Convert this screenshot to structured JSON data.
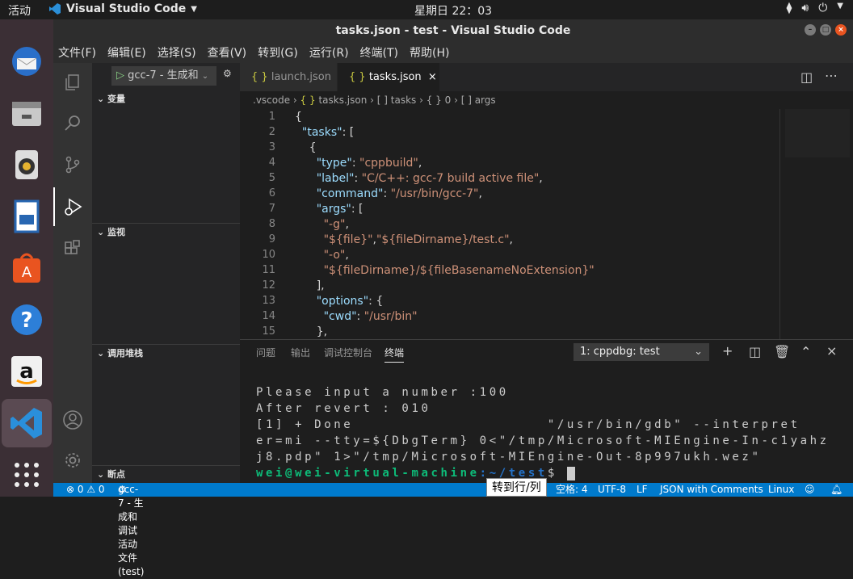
{
  "topbar": {
    "activities": "活动",
    "app_name": "Visual Studio Code",
    "clock": "星期日 22：03"
  },
  "dock": {
    "items": [
      "thunderbird-icon",
      "files-icon",
      "rhythmbox-icon",
      "libreoffice-writer-icon",
      "software-center-icon",
      "help-icon",
      "amazon-icon",
      "vscode-icon",
      "app-grid-icon"
    ]
  },
  "window": {
    "title": "tasks.json - test - Visual Studio Code"
  },
  "menu": [
    "文件(F)",
    "编辑(E)",
    "选择(S)",
    "查看(V)",
    "转到(G)",
    "运行(R)",
    "终端(T)",
    "帮助(H)"
  ],
  "run_config": {
    "label": "gcc-7 - 生成和"
  },
  "sidebar": {
    "variables": "变量",
    "watch": "监视",
    "callstack": "调用堆栈",
    "breakpoints": "断点"
  },
  "tabs": [
    {
      "label": "launch.json",
      "active": false
    },
    {
      "label": "tasks.json",
      "active": true
    }
  ],
  "breadcrumb": {
    "p1": ".vscode",
    "p2": "tasks.json",
    "p3": "[ ] tasks",
    "p4": "{ } 0",
    "p5": "[ ] args"
  },
  "editor": {
    "lines": [
      {
        "n": "1",
        "t": "{"
      },
      {
        "n": "2",
        "t": "  \"tasks\": ["
      },
      {
        "n": "3",
        "t": "    {"
      },
      {
        "n": "4",
        "t": "      \"type\": \"cppbuild\","
      },
      {
        "n": "5",
        "t": "      \"label\": \"C/C++: gcc-7 build active file\","
      },
      {
        "n": "6",
        "t": "      \"command\": \"/usr/bin/gcc-7\","
      },
      {
        "n": "7",
        "t": "      \"args\": ["
      },
      {
        "n": "8",
        "t": "        \"-g\","
      },
      {
        "n": "9",
        "t": "        \"${file}\",\"${fileDirname}/test.c\","
      },
      {
        "n": "10",
        "t": "        \"-o\","
      },
      {
        "n": "11",
        "t": "        \"${fileDirname}/${fileBasenameNoExtension}\""
      },
      {
        "n": "12",
        "t": "      ],"
      },
      {
        "n": "13",
        "t": "      \"options\": {"
      },
      {
        "n": "14",
        "t": "        \"cwd\": \"/usr/bin\""
      },
      {
        "n": "15",
        "t": "      },"
      }
    ]
  },
  "panel": {
    "tabs": [
      "问题",
      "输出",
      "调试控制台",
      "终端"
    ],
    "active_tab": "终端",
    "terminal_select": "1: cppdbg: test"
  },
  "terminal": {
    "lines": [
      "Please input a number :100",
      "After revert : 010",
      "[1] + Done                    \"/usr/bin/gdb\" --interpret",
      "er=mi --tty=${DbgTerm} 0<\"/tmp/Microsoft-MIEngine-In-c1yahz",
      "j8.pdp\" 1>\"/tmp/Microsoft-MIEngine-Out-8p997ukh.wez\""
    ],
    "prompt_user": "wei@wei-virtual-machine",
    "prompt_path": ":~/test",
    "prompt_end": "$ "
  },
  "status": {
    "errors": "⊗ 0 ⚠ 0",
    "debug": "gcc-7 - 生成和调试活动文件 (test)",
    "spaces": "空格: 4",
    "encoding": "UTF-8",
    "eol": "LF",
    "lang": "JSON with Comments",
    "os": "Linux"
  },
  "tooltip": "转到行/列"
}
